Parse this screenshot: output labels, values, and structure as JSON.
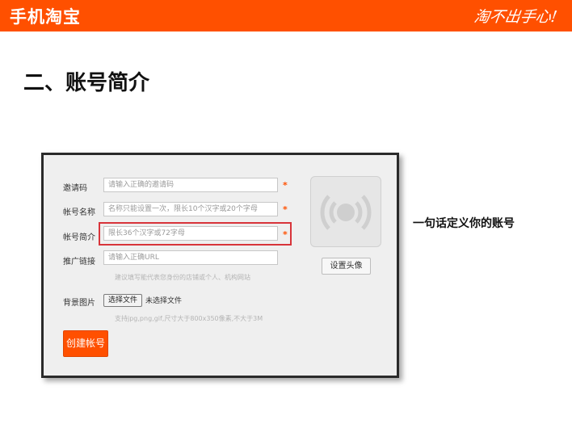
{
  "header": {
    "brand": "手机淘宝",
    "slogan": "淘不出手心!"
  },
  "page": {
    "heading": "二、账号简介",
    "caption": "一句话定义你的账号"
  },
  "form": {
    "invite": {
      "label": "邀请码",
      "placeholder": "请输入正确的邀请码"
    },
    "name": {
      "label": "帐号名称",
      "placeholder": "名称只能设置一次，限长10个汉字或20个字母"
    },
    "intro": {
      "label": "帐号简介",
      "placeholder": "限长36个汉字或72字母"
    },
    "link": {
      "label": "推广链接",
      "placeholder": "请输入正确URL",
      "hint": "建议填写能代表您身份的店铺或个人、机构网站"
    },
    "background": {
      "label": "背景图片",
      "choose_button": "选择文件",
      "no_file": "未选择文件",
      "hint": "支持jpg,png,gif,尺寸大于800x350像素,不大于3M"
    },
    "required_mark": "*",
    "set_avatar_button": "设置头像",
    "create_button": "创建帐号"
  },
  "colors": {
    "brand_orange": "#ff5000",
    "highlight_red": "#d8343a"
  }
}
